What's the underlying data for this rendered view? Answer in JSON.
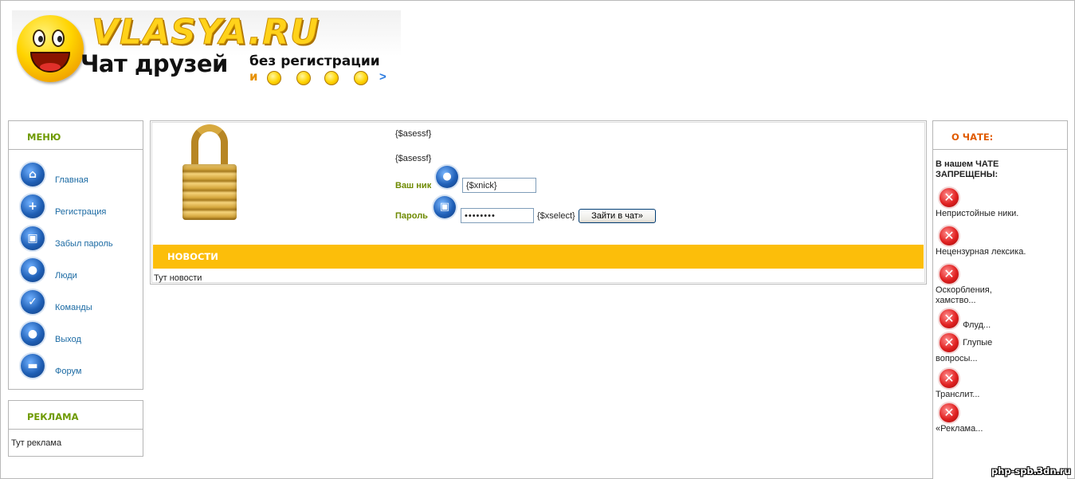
{
  "header": {
    "logo_title": "VLASYA.RU",
    "logo_sub1": "Чат друзей",
    "logo_sub2": "без регистрации",
    "logo_and": "и",
    "logo_arrow": ">"
  },
  "menu": {
    "title": "МЕНЮ",
    "items": [
      {
        "label": "Главная",
        "icon": "home-icon",
        "glyph": "⌂"
      },
      {
        "label": "Регистрация",
        "icon": "plus-icon",
        "glyph": "+"
      },
      {
        "label": "Забыл пароль",
        "icon": "lock-icon",
        "glyph": "🔒"
      },
      {
        "label": "Люди",
        "icon": "user-icon",
        "glyph": "●"
      },
      {
        "label": "Команды",
        "icon": "check-icon",
        "glyph": "✓"
      },
      {
        "label": "Выход",
        "icon": "exit-icon",
        "glyph": "●"
      },
      {
        "label": "Форум",
        "icon": "forum-icon",
        "glyph": "▬"
      }
    ]
  },
  "ads": {
    "title": "РЕКЛАМА",
    "body": "Тут реклама"
  },
  "login": {
    "var_line1": "{$asessf}",
    "var_line2": "{$asessf}",
    "nick_label": "Ваш ник",
    "nick_value": "{$xnick}",
    "password_label": "Пароль",
    "password_value": "••••••••",
    "select_var": "{$xselect}",
    "submit_label": "Зайти в чат»"
  },
  "news": {
    "title": "НОВОСТИ",
    "body": "Тут новости"
  },
  "about": {
    "title": "О ЧАТЕ:",
    "intro": "В нашем ЧАТЕ ЗАПРЕЩЕНЫ:",
    "rules": [
      "Непристойные ники.",
      "Нецензурная лексика.",
      "Оскорбления, хамство...",
      "Флуд...",
      "Глупые вопросы...",
      "Транслит...",
      "«Реклама..."
    ]
  },
  "watermark": "php-spb.3dn.ru",
  "colors": {
    "menu_heading": "#6e9a00",
    "about_heading": "#e05a00",
    "news_bar": "#fcbe0a",
    "link": "#1b6aa3"
  }
}
